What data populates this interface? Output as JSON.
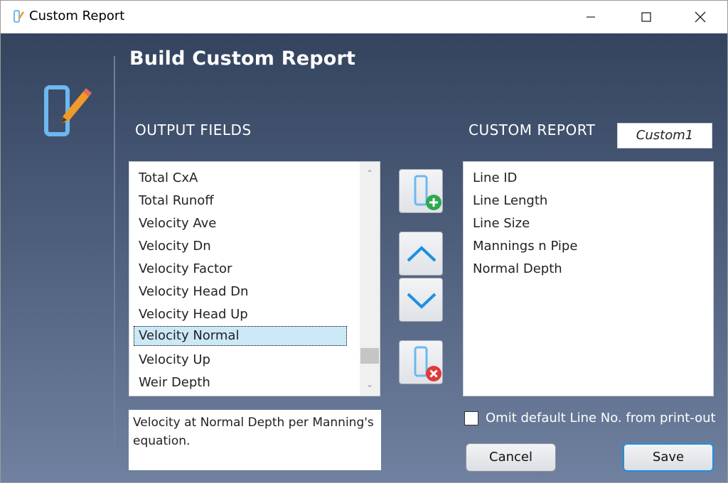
{
  "window": {
    "title": "Custom Report",
    "app_icon": "report-edit-icon",
    "controls": [
      "minimize-icon",
      "maximize-icon",
      "close-icon"
    ]
  },
  "heading": "Build Custom Report",
  "output_fields": {
    "label": "OUTPUT FIELDS",
    "items": [
      "Total CxA",
      "Total Runoff",
      "Velocity Ave",
      "Velocity Dn",
      "Velocity Factor",
      "Velocity Head Dn",
      "Velocity Head Up",
      "Velocity Normal",
      "Velocity Up",
      "Weir Depth"
    ],
    "selected": "Velocity Normal"
  },
  "custom_report": {
    "label": "CUSTOM REPORT",
    "name": "Custom1",
    "items": [
      "Line ID",
      "Line Length",
      "Line Size",
      "Mannings n Pipe",
      "Normal Depth"
    ]
  },
  "tools": {
    "add": "add-field-icon",
    "up": "move-up-icon",
    "down": "move-down-icon",
    "remove": "remove-field-icon"
  },
  "description": "Velocity at Normal Depth per Manning's equation.",
  "omit_checkbox": {
    "label": "Omit default Line No. from print-out",
    "checked": false
  },
  "buttons": {
    "cancel": "Cancel",
    "save": "Save"
  },
  "colors": {
    "background_top": "#34445f",
    "background_bottom": "#7081a0",
    "accent_blue": "#1e8fe0",
    "icon_blue": "#6db8f0",
    "icon_orange": "#f09a2c",
    "add_green": "#2fa84f",
    "remove_red": "#e03a3a",
    "selection": "#cce8f7"
  }
}
